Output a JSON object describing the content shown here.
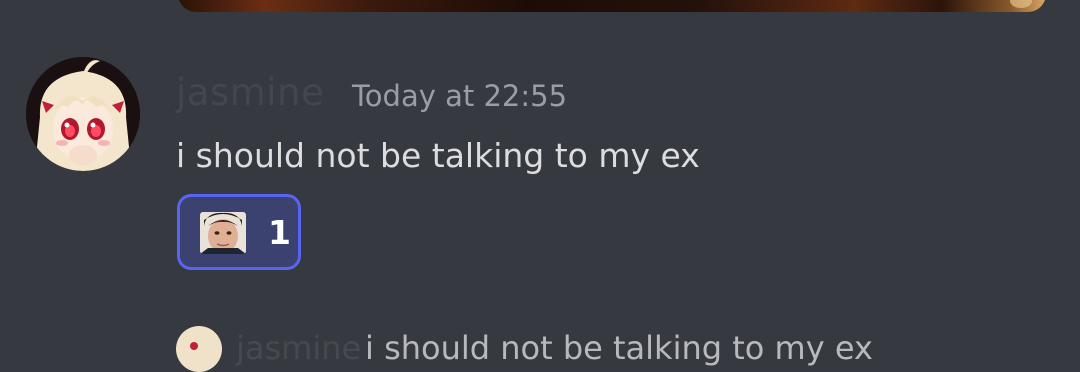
{
  "message": {
    "author": "jasmine",
    "timestamp": "Today at 22:55",
    "text": "i should not be talking to my ex",
    "reaction": {
      "emoji": "custom-face-emoji",
      "count": "1"
    }
  },
  "next_message": {
    "author": "jasmine",
    "text": "i should not be talking to my ex"
  },
  "colors": {
    "background": "#36393f",
    "reaction_border": "#5865f2",
    "reaction_fill": "#3c4270",
    "message_text": "#dcddde",
    "timestamp": "#9a9da4"
  }
}
